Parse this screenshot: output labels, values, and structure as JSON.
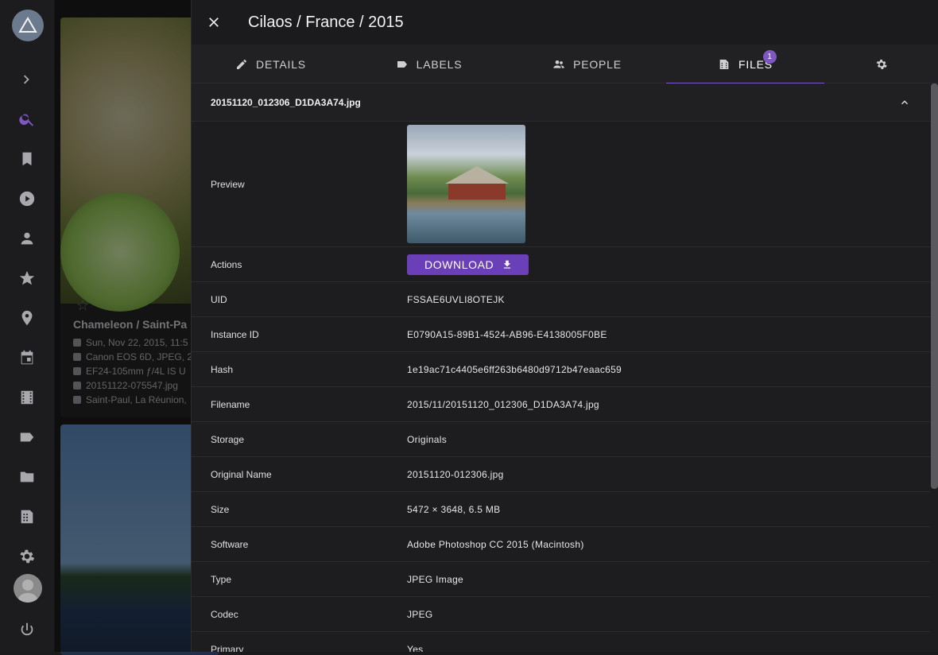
{
  "rail": {
    "items": [
      "expand-icon",
      "search-icon",
      "bookmark-icon",
      "play-icon",
      "person-icon",
      "star-icon",
      "location-icon",
      "calendar-icon",
      "film-icon",
      "label-icon",
      "folder-icon",
      "library-icon",
      "settings-icon"
    ],
    "power_icon": "power-icon"
  },
  "background_card": {
    "title": "Chameleon / Saint-Pa",
    "lines": [
      "Sun, Nov 22, 2015, 11:5",
      "Canon EOS 6D, JPEG, 2",
      "EF24-105mm ƒ/4L IS U",
      "20151122-075547.jpg",
      "Saint-Paul, La Réunion,"
    ]
  },
  "dialog": {
    "title": "Cilaos / France / 2015",
    "tabs": [
      {
        "label": "DETAILS",
        "icon": "pencil-icon"
      },
      {
        "label": "LABELS",
        "icon": "label-icon"
      },
      {
        "label": "PEOPLE",
        "icon": "people-icon"
      },
      {
        "label": "FILES",
        "icon": "files-icon",
        "badge": "1",
        "active": true
      },
      {
        "label": "",
        "icon": "gear-icon"
      }
    ],
    "file": {
      "name": "20151120_012306_D1DA3A74.jpg",
      "rows": [
        {
          "key": "Preview",
          "value": ""
        },
        {
          "key": "Actions",
          "value": "DOWNLOAD"
        },
        {
          "key": "UID",
          "value": "FSSAE6UVLI8OTEJK"
        },
        {
          "key": "Instance ID",
          "value": "E0790A15-89B1-4524-AB96-E4138005F0BE"
        },
        {
          "key": "Hash",
          "value": "1e19ac71c4405e6ff263b6480d9712b47eaac659"
        },
        {
          "key": "Filename",
          "value": "2015/11/20151120_012306_D1DA3A74.jpg"
        },
        {
          "key": "Storage",
          "value": "Originals"
        },
        {
          "key": "Original Name",
          "value": "20151120-012306.jpg"
        },
        {
          "key": "Size",
          "value": "5472 × 3648, 6.5 MB"
        },
        {
          "key": "Software",
          "value": "Adobe Photoshop CC 2015 (Macintosh)"
        },
        {
          "key": "Type",
          "value": "JPEG Image"
        },
        {
          "key": "Codec",
          "value": "JPEG"
        },
        {
          "key": "Primary",
          "value": "Yes"
        }
      ]
    }
  },
  "colors": {
    "accent": "#7e57c2",
    "button": "#6a3fb8",
    "background": "#1d1d20"
  }
}
